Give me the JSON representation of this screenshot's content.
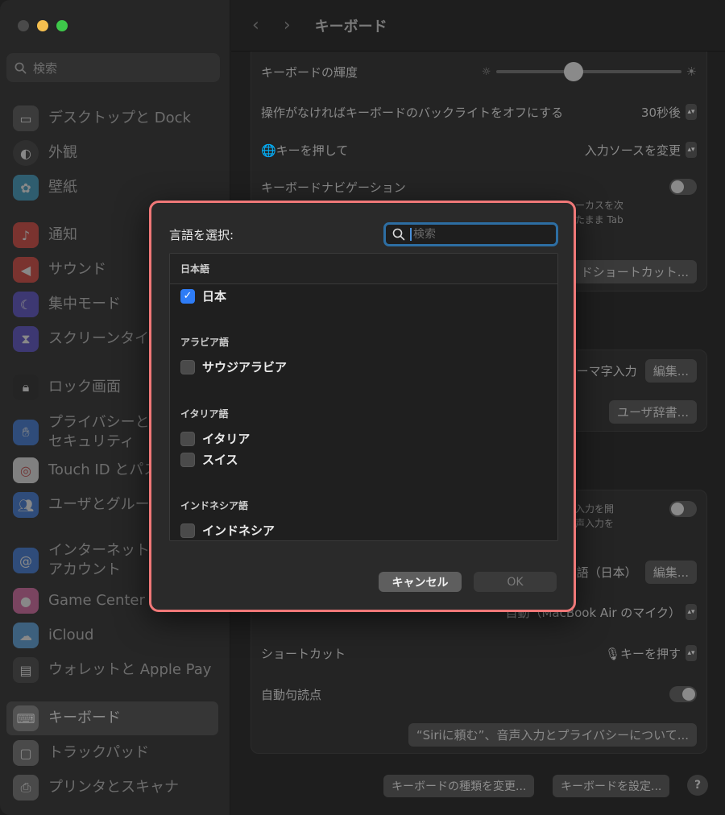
{
  "window": {
    "title": "キーボード"
  },
  "sidebar": {
    "search_placeholder": "検索",
    "items": [
      {
        "label": "デスクトップと Dock",
        "icon": "dock-icon",
        "color": "#555555"
      },
      {
        "label": "外観",
        "icon": "appearance-icon",
        "color": "#3a3a3a"
      },
      {
        "label": "壁紙",
        "icon": "wallpaper-icon",
        "color": "#3aa0c8"
      },
      {
        "label": "通知",
        "icon": "bell-icon",
        "color": "#e0443a"
      },
      {
        "label": "サウンド",
        "icon": "speaker-icon",
        "color": "#e0443a"
      },
      {
        "label": "集中モード",
        "icon": "moon-icon",
        "color": "#5a4fcf"
      },
      {
        "label": "スクリーンタイム",
        "icon": "hourglass-icon",
        "color": "#5a4fcf"
      },
      {
        "label": "ロック画面",
        "icon": "lock-icon",
        "color": "#222222"
      },
      {
        "label": "プライバシーとセキュリティ",
        "icon": "hand-icon",
        "color": "#3a7be0"
      },
      {
        "label": "Touch ID とパスワード",
        "icon": "fingerprint-icon",
        "color": "#eeeeee"
      },
      {
        "label": "ユーザとグループ",
        "icon": "users-icon",
        "color": "#3a7be0"
      },
      {
        "label": "インターネットアカウント",
        "icon": "at-icon",
        "color": "#3a7be0"
      },
      {
        "label": "Game Center",
        "icon": "game-center-icon",
        "color": "#e06aa8"
      },
      {
        "label": "iCloud",
        "icon": "cloud-icon",
        "color": "#5aa8e8"
      },
      {
        "label": "ウォレットと Apple Pay",
        "icon": "wallet-icon",
        "color": "#444444"
      },
      {
        "label": "キーボード",
        "icon": "keyboard-icon",
        "color": "#777777",
        "selected": true
      },
      {
        "label": "トラックパッド",
        "icon": "trackpad-icon",
        "color": "#777777"
      },
      {
        "label": "プリンタとスキャナ",
        "icon": "printer-icon",
        "color": "#777777"
      }
    ]
  },
  "main": {
    "rows": {
      "brightness": "キーボードの輝度",
      "backlight_off": "操作がなければキーボードのバックライトをオフにする",
      "backlight_off_value": "30秒後",
      "globe_key": "🌐キーを押して",
      "globe_key_value": "入力ソースを変更",
      "navigation": "キーボードナビゲーション",
      "nav_desc_1": "ーカスを次",
      "nav_desc_2": "たまま Tab",
      "shortcuts_btn": "ドショートカット...",
      "romaji": "ーマ字入力",
      "edit_btn": "編集...",
      "user_dict_btn": "ユーザ辞書...",
      "dictation_desc_1": "入力を開",
      "dictation_desc_2": "声入力を",
      "language_value": "本語（日本）",
      "edit_btn_2": "編集...",
      "mic_value": "自動（MacBook Air のマイク）",
      "shortcut_label": "ショートカット",
      "shortcut_value": "🎙キーを押す",
      "auto_punct": "自動句読点",
      "siri_btn": "“Siriに頼む”、音声入力とプライバシーについて..."
    },
    "brightness_level": 0.42,
    "bottom": {
      "change_type": "キーボードの種類を変更...",
      "setup": "キーボードを設定...",
      "help": "?"
    }
  },
  "dialog": {
    "label": "言語を選択:",
    "search_placeholder": "検索",
    "list_header": "日本語",
    "groups": [
      {
        "label": "アラビア語"
      },
      {
        "label": "イタリア語"
      },
      {
        "label": "インドネシア語"
      }
    ],
    "items": {
      "japan": {
        "label": "日本",
        "checked": true
      },
      "saudi": {
        "label": "サウジアラビア",
        "checked": false
      },
      "italy": {
        "label": "イタリア",
        "checked": false
      },
      "swiss": {
        "label": "スイス",
        "checked": false
      },
      "indonesia": {
        "label": "インドネシア",
        "checked": false
      }
    },
    "cancel": "キャンセル",
    "ok": "OK"
  }
}
